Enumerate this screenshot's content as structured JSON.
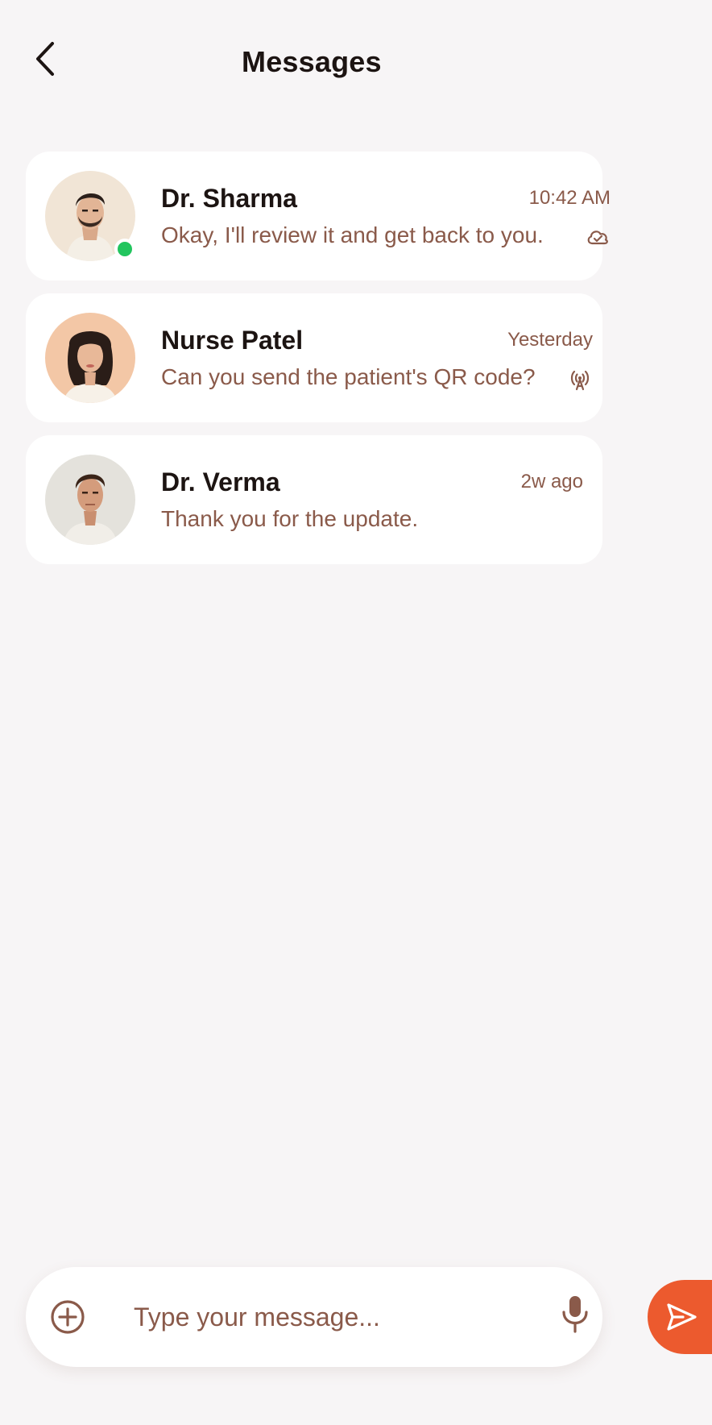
{
  "header": {
    "title": "Messages",
    "back_icon": "chevron-left-icon"
  },
  "chats": [
    {
      "name": "Dr. Sharma",
      "time": "10:42 AM",
      "preview": "Okay, I'll review it and get back to you.",
      "status_icon": "cloud-check-icon",
      "online": true
    },
    {
      "name": "Nurse Patel",
      "time": "Yesterday",
      "preview": "Can you send the patient's QR code?",
      "status_icon": "broadcast-icon",
      "online": false
    },
    {
      "name": "Dr. Verma",
      "time": "2w ago",
      "preview": "Thank you for the update.",
      "online": false
    }
  ],
  "composer": {
    "placeholder": "Type your message...",
    "attach_icon": "plus-circle-icon",
    "mic_icon": "microphone-icon",
    "send_icon": "send-icon"
  },
  "colors": {
    "background": "#f7f5f6",
    "card": "#ffffff",
    "accent": "#ec5a2e",
    "text_primary": "#1c1412",
    "text_secondary": "#8a5a4a",
    "online": "#22c55e"
  }
}
